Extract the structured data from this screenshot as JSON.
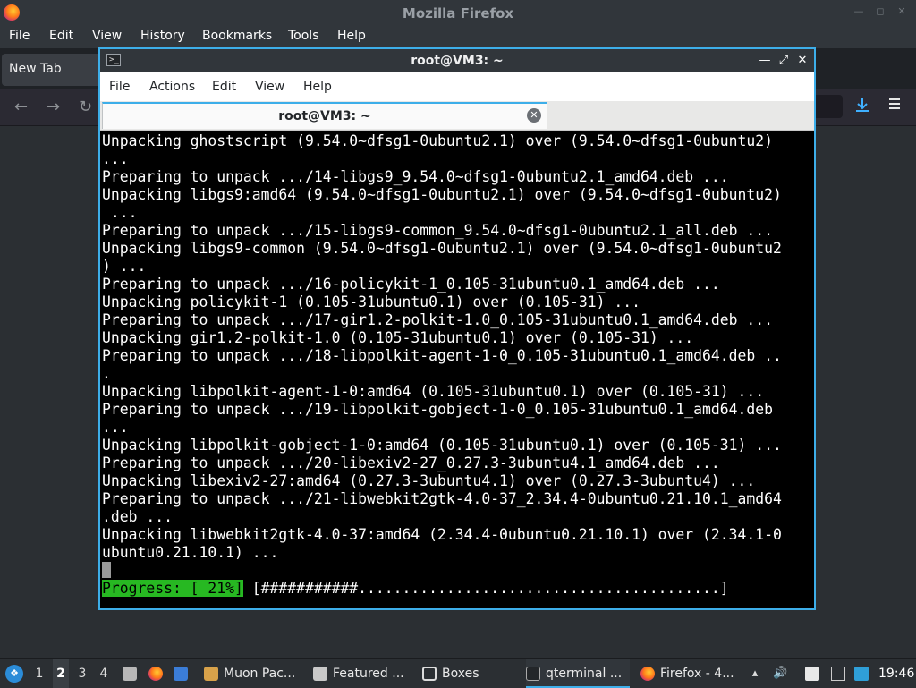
{
  "firefox": {
    "title": "Mozilla Firefox",
    "menu": [
      "File",
      "Edit",
      "View",
      "History",
      "Bookmarks",
      "Tools",
      "Help"
    ],
    "tab_label": "New Tab",
    "nav_back": "←",
    "nav_forward": "→",
    "nav_reload": "↻",
    "download_icon": "download-icon",
    "menu_icon": "hamburger-menu-icon"
  },
  "terminal": {
    "title": "root@VM3: ~",
    "menu": [
      "File",
      "Actions",
      "Edit",
      "View",
      "Help"
    ],
    "tab_label": "root@VM3: ~",
    "lines": [
      "Unpacking ghostscript (9.54.0~dfsg1-0ubuntu2.1) over (9.54.0~dfsg1-0ubuntu2)",
      "...",
      "Preparing to unpack .../14-libgs9_9.54.0~dfsg1-0ubuntu2.1_amd64.deb ...",
      "Unpacking libgs9:amd64 (9.54.0~dfsg1-0ubuntu2.1) over (9.54.0~dfsg1-0ubuntu2)",
      " ...",
      "Preparing to unpack .../15-libgs9-common_9.54.0~dfsg1-0ubuntu2.1_all.deb ...",
      "Unpacking libgs9-common (9.54.0~dfsg1-0ubuntu2.1) over (9.54.0~dfsg1-0ubuntu2",
      ") ...",
      "Preparing to unpack .../16-policykit-1_0.105-31ubuntu0.1_amd64.deb ...",
      "Unpacking policykit-1 (0.105-31ubuntu0.1) over (0.105-31) ...",
      "Preparing to unpack .../17-gir1.2-polkit-1.0_0.105-31ubuntu0.1_amd64.deb ...",
      "Unpacking gir1.2-polkit-1.0 (0.105-31ubuntu0.1) over (0.105-31) ...",
      "Preparing to unpack .../18-libpolkit-agent-1-0_0.105-31ubuntu0.1_amd64.deb ..",
      ".",
      "Unpacking libpolkit-agent-1-0:amd64 (0.105-31ubuntu0.1) over (0.105-31) ...",
      "Preparing to unpack .../19-libpolkit-gobject-1-0_0.105-31ubuntu0.1_amd64.deb",
      "...",
      "Unpacking libpolkit-gobject-1-0:amd64 (0.105-31ubuntu0.1) over (0.105-31) ...",
      "Preparing to unpack .../20-libexiv2-27_0.27.3-3ubuntu4.1_amd64.deb ...",
      "Unpacking libexiv2-27:amd64 (0.27.3-3ubuntu4.1) over (0.27.3-3ubuntu4) ...",
      "Preparing to unpack .../21-libwebkit2gtk-4.0-37_2.34.4-0ubuntu0.21.10.1_amd64",
      ".deb ...",
      "Unpacking libwebkit2gtk-4.0-37:amd64 (2.34.4-0ubuntu0.21.10.1) over (2.34.1-0",
      "ubuntu0.21.10.1) ..."
    ],
    "progress_label": "Progress: [ 21%]",
    "progress_bar": " [###########.........................................]",
    "progress_percent": 21
  },
  "taskbar": {
    "workspaces": [
      "1",
      "2",
      "3",
      "4"
    ],
    "active_workspace": "2",
    "tasks": [
      {
        "label": "Muon Pac...",
        "icon": "package-manager-icon"
      },
      {
        "label": "Featured ...",
        "icon": "software-center-icon"
      },
      {
        "label": "Boxes",
        "icon": "boxes-icon"
      },
      {
        "label": "qterminal ...",
        "icon": "terminal-icon"
      },
      {
        "label": "Firefox - 4...",
        "icon": "firefox-icon"
      }
    ],
    "clock": "19:46"
  },
  "colors": {
    "accent": "#3daee9",
    "progress_green": "#27b822",
    "terminal_bg": "#000000"
  }
}
